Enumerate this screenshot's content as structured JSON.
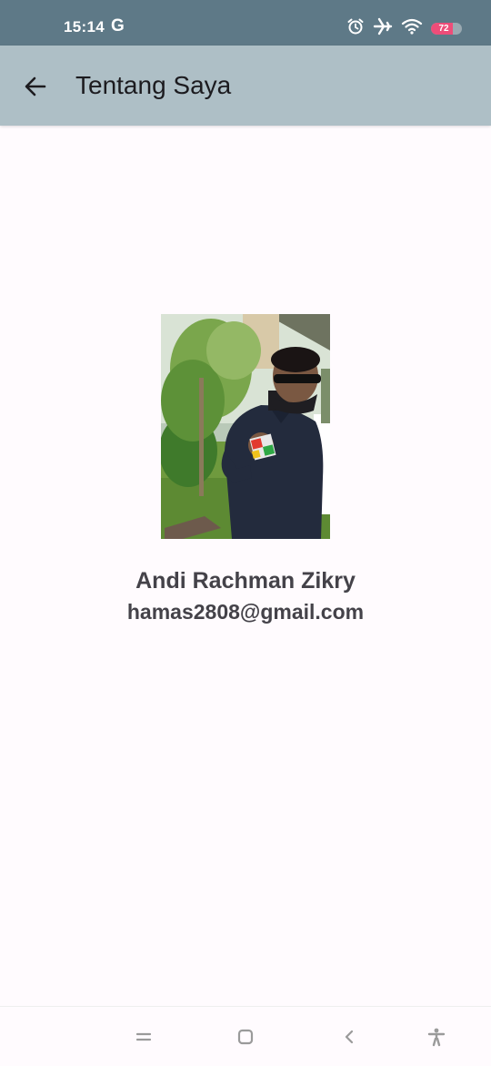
{
  "status_bar": {
    "time": "15:14",
    "g_label": "G",
    "battery_level": "72",
    "battery_fraction": 0.72,
    "icons": [
      "alarm-icon",
      "airplane-icon",
      "wifi-icon",
      "battery-icon"
    ]
  },
  "app_bar": {
    "title": "Tentang Saya",
    "back_icon": "arrow-back-icon",
    "background": "#aebfc6"
  },
  "profile": {
    "name": "Andi Rachman Zikry",
    "email": "hamas2808@gmail.com",
    "photo": "profile-photo"
  },
  "nav_bar": {
    "icons": [
      "menu-icon",
      "home-icon",
      "back-icon",
      "accessibility-icon"
    ]
  },
  "colors": {
    "status_bar": "#5e7987",
    "app_bar": "#aebfc6",
    "background": "#fffbfe",
    "text": "#444249",
    "battery": "#ee4d79"
  }
}
